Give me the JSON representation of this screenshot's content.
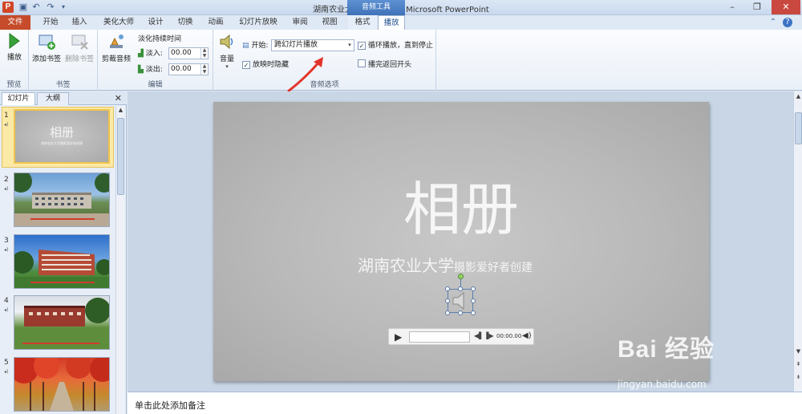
{
  "window": {
    "title": "湖南农业大学MTV.pptx - Microsoft PowerPoint",
    "context_tab_group": "音频工具",
    "app_icon_label": "P"
  },
  "tabs": {
    "file": "文件",
    "items": [
      "开始",
      "插入",
      "美化大师",
      "设计",
      "切换",
      "动画",
      "幻灯片放映",
      "审阅",
      "视图",
      "格式",
      "播放"
    ],
    "active": "播放"
  },
  "ribbon": {
    "preview": {
      "play": "播放",
      "group": "预览"
    },
    "bookmarks": {
      "add": "添加书签",
      "remove": "删除书签",
      "group": "书签"
    },
    "editing": {
      "trim": "剪裁音频",
      "fade_duration": "淡化持续时间",
      "fade_in_label": "淡入:",
      "fade_in_value": "00.00",
      "fade_out_label": "淡出:",
      "fade_out_value": "00.00",
      "group": "编辑"
    },
    "audio_options": {
      "volume": "音量",
      "start_label": "开始:",
      "start_value": "跨幻灯片播放",
      "hide_during_show": "放映时隐藏",
      "loop_until_stopped": "循环播放，直到停止",
      "rewind_after_playing": "播完返回开头",
      "hide_checked": true,
      "loop_checked": true,
      "rewind_checked": false,
      "group": "音频选项"
    }
  },
  "left_panel": {
    "tab_slides": "幻灯片",
    "tab_outline": "大纲",
    "close": "✕",
    "thumbnails": [
      {
        "number": "1",
        "title": "相册",
        "subtitle": "湖南农业大学摄影爱好者创建"
      },
      {
        "number": "2",
        "caption": ""
      },
      {
        "number": "3",
        "caption": ""
      },
      {
        "number": "4",
        "caption": ""
      },
      {
        "number": "5",
        "caption": ""
      }
    ]
  },
  "slide": {
    "title": "相册",
    "subtitle_main": "湖南农业大学",
    "subtitle_small": "摄影爱好者创建",
    "player_time": "00:00.00"
  },
  "notes": {
    "placeholder": "单击此处添加备注"
  },
  "watermark": {
    "brand": "Bai 经验",
    "url": "jingyan.baidu.com"
  },
  "colors": {
    "file_tab": "#c54b2a",
    "context_tab": "#3f72b8",
    "annotation_arrow": "#e2342b"
  }
}
